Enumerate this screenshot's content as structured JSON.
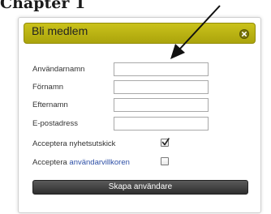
{
  "header": {
    "caption_text": "Chapter 1"
  },
  "dialog": {
    "title": "Bli medlem",
    "fields": [
      {
        "label": "Användarnamn",
        "value": "",
        "placeholder": ""
      },
      {
        "label": "Förnamn",
        "value": "",
        "placeholder": ""
      },
      {
        "label": "Efternamn",
        "value": "",
        "placeholder": ""
      },
      {
        "label": "E-postadress",
        "value": "",
        "placeholder": ""
      }
    ],
    "newsletter": {
      "label": "Acceptera nyhetsutskick",
      "checked": true
    },
    "terms": {
      "label_prefix": "Acceptera ",
      "label_link": "användarvillkoren",
      "checked": false
    },
    "submit_label": "Skapa användare"
  },
  "colors": {
    "titlebar": "#bfb718",
    "link": "#2d4fa6",
    "button": "#3a3a3a"
  },
  "icons": {
    "close": "close-icon",
    "check": "checkmark-icon",
    "pointer": "arrow-annotation"
  }
}
